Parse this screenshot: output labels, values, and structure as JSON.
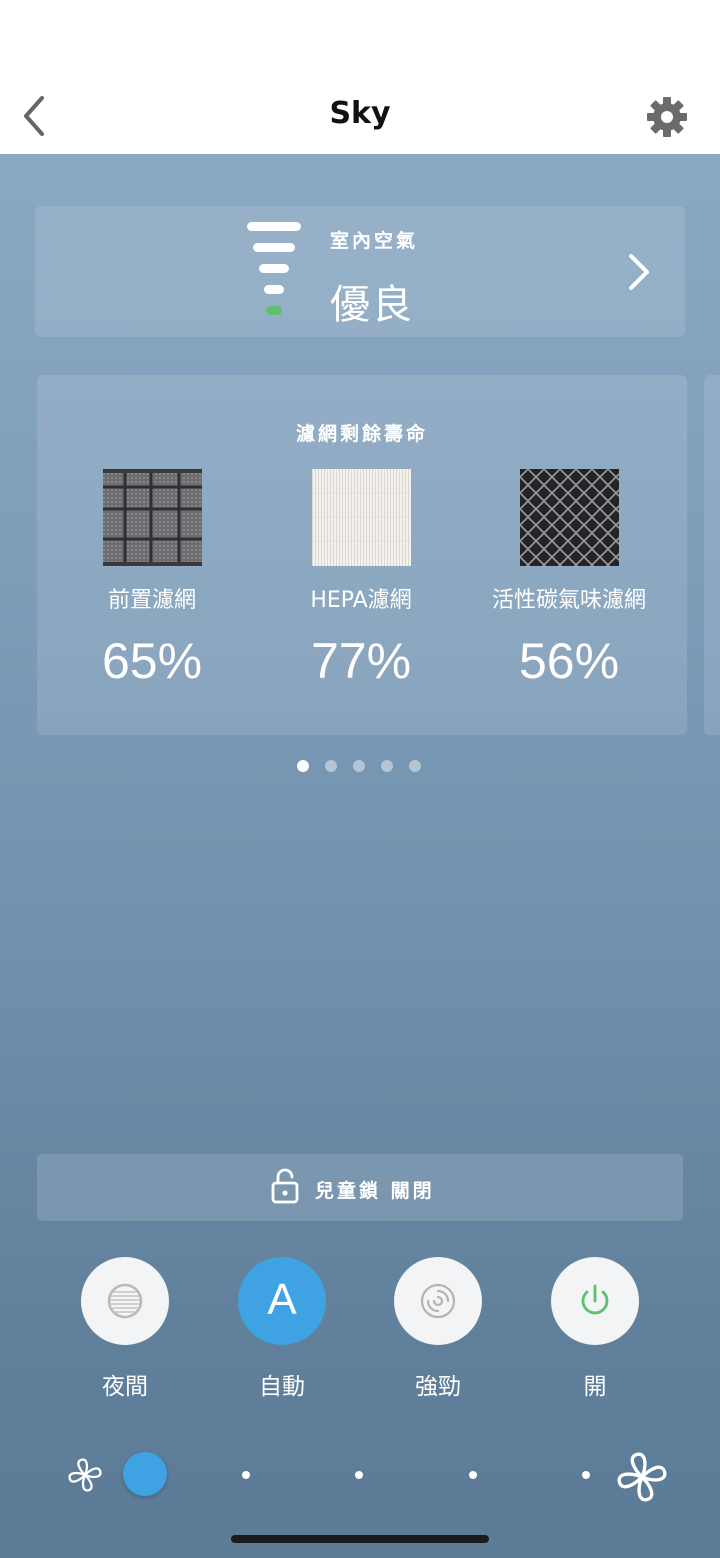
{
  "header": {
    "title": "Sky",
    "back_icon": "chevron-left-icon",
    "settings_icon": "gear-icon"
  },
  "air_quality": {
    "label": "室內空氣",
    "value": "優良",
    "level_color": "#5cc06c",
    "chevron_icon": "chevron-right-icon"
  },
  "filters": {
    "title": "濾網剩餘壽命",
    "items": [
      {
        "name": "前置濾網",
        "percent": "65%"
      },
      {
        "name": "HEPA濾網",
        "percent": "77%"
      },
      {
        "name": "活性碳氣味濾網",
        "percent": "56%"
      }
    ]
  },
  "pager": {
    "count": 5,
    "active_index": 0
  },
  "child_lock": {
    "icon": "unlock-icon",
    "label": "兒童鎖 關閉"
  },
  "modes": [
    {
      "label": "夜間",
      "icon": "night-mode-icon",
      "active": false
    },
    {
      "label": "自動",
      "icon_text": "A",
      "active": true
    },
    {
      "label": "強勁",
      "icon": "turbo-swirl-icon",
      "active": false
    },
    {
      "label": "開",
      "icon": "power-icon",
      "active": false
    }
  ],
  "fan_speed": {
    "min_icon": "fan-small-icon",
    "max_icon": "fan-large-icon",
    "level": 1,
    "steps": 6
  },
  "colors": {
    "accent": "#3ea2e3",
    "power_green": "#5cc06c"
  }
}
